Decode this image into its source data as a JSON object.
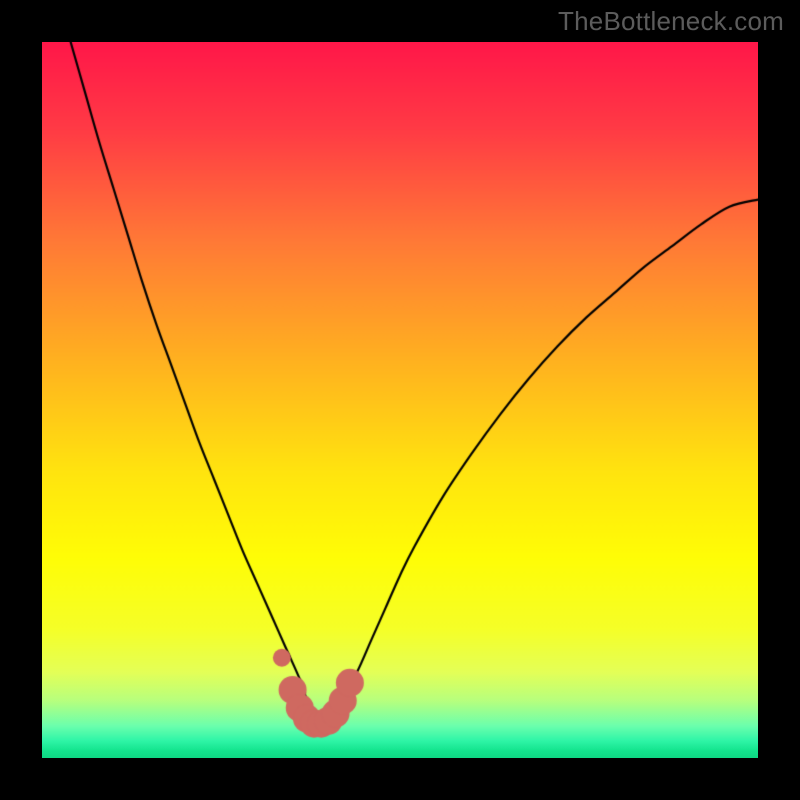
{
  "watermark": "TheBottleneck.com",
  "colors": {
    "frame": "#000000",
    "curve": "#000000",
    "marker_fill": "#cf6960",
    "marker_stroke": "#cf6960",
    "gradient_stops": [
      {
        "offset": 0.0,
        "color": "#ff1749"
      },
      {
        "offset": 0.12,
        "color": "#ff3a45"
      },
      {
        "offset": 0.28,
        "color": "#ff7a36"
      },
      {
        "offset": 0.45,
        "color": "#ffb31f"
      },
      {
        "offset": 0.6,
        "color": "#ffe40f"
      },
      {
        "offset": 0.72,
        "color": "#fffd06"
      },
      {
        "offset": 0.82,
        "color": "#f5ff28"
      },
      {
        "offset": 0.88,
        "color": "#e4ff57"
      },
      {
        "offset": 0.92,
        "color": "#b7ff7e"
      },
      {
        "offset": 0.955,
        "color": "#6cffad"
      },
      {
        "offset": 0.975,
        "color": "#31f6a8"
      },
      {
        "offset": 0.99,
        "color": "#13e48e"
      },
      {
        "offset": 1.0,
        "color": "#0fd884"
      }
    ]
  },
  "chart_data": {
    "type": "line",
    "title": "",
    "xlabel": "",
    "ylabel": "",
    "xlim": [
      0,
      100
    ],
    "ylim": [
      0,
      100
    ],
    "x_min_at": 38,
    "series": [
      {
        "name": "bottleneck-curve",
        "x": [
          4,
          6,
          8,
          10,
          12,
          14,
          16,
          18,
          20,
          22,
          24,
          26,
          28,
          30,
          32,
          34,
          36,
          37,
          38,
          39,
          40,
          42,
          44,
          46,
          48,
          50,
          52,
          56,
          60,
          64,
          68,
          72,
          76,
          80,
          84,
          88,
          92,
          96,
          100
        ],
        "y": [
          100,
          93,
          86,
          79.5,
          73,
          66.5,
          60.5,
          55,
          49.5,
          44,
          39,
          34,
          29,
          24.5,
          20,
          15.5,
          11,
          8,
          5,
          5,
          5.5,
          8.5,
          12,
          16.5,
          21,
          25.5,
          29.5,
          36.5,
          42.5,
          48,
          53,
          57.5,
          61.5,
          65,
          68.5,
          71.5,
          74.5,
          77,
          78
        ]
      }
    ],
    "markers": {
      "name": "highlighted-band",
      "x": [
        33.5,
        35,
        36,
        37,
        38,
        39,
        40,
        41,
        42,
        43
      ],
      "y": [
        14,
        9.5,
        7,
        5.5,
        4.8,
        4.8,
        5.2,
        6.2,
        8,
        10.5
      ],
      "size": [
        9,
        14,
        14,
        14,
        14,
        14,
        14,
        14,
        14,
        14
      ]
    }
  }
}
